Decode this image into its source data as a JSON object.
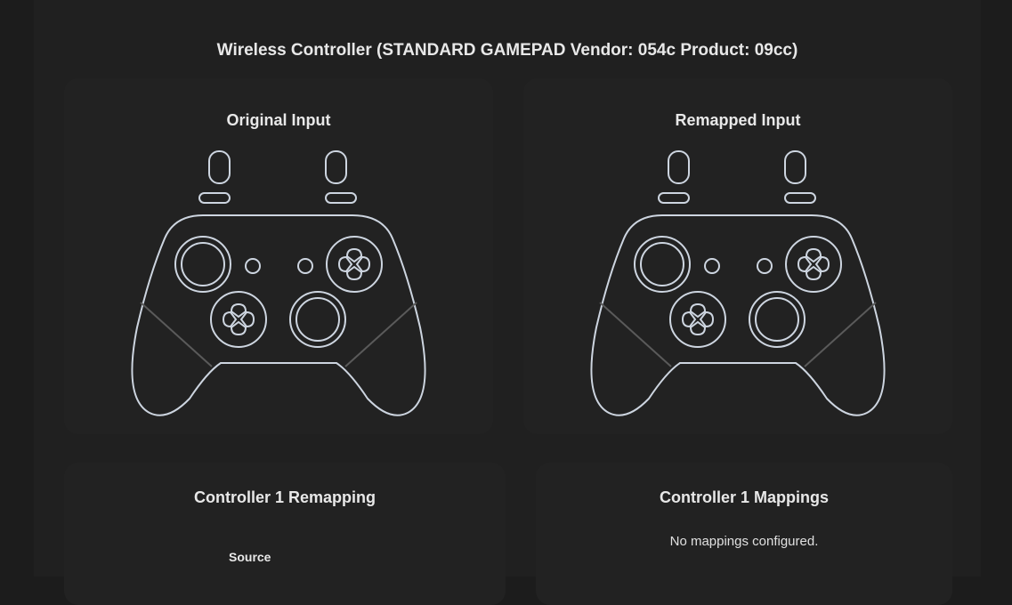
{
  "device": {
    "title": "Wireless Controller (STANDARD GAMEPAD Vendor: 054c Product: 09cc)"
  },
  "original_panel": {
    "title": "Original Input",
    "graphic": "gamepad-outline"
  },
  "remapped_panel": {
    "title": "Remapped Input",
    "graphic": "gamepad-outline"
  },
  "remapping_panel": {
    "title": "Controller 1 Remapping",
    "column_source": "Source"
  },
  "mappings_panel": {
    "title": "Controller 1 Mappings",
    "empty_message": "No mappings configured."
  },
  "colors": {
    "background": "#1c1c1c",
    "panel": "#222222",
    "outline": "#cdd5e0",
    "divider": "#5a5a5a",
    "text": "#e8e8e8"
  }
}
